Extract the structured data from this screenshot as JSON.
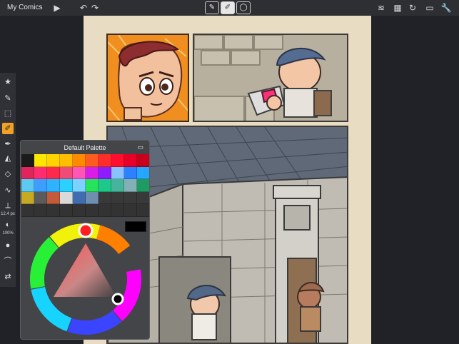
{
  "app": {
    "title": "My Comics"
  },
  "topbar": {
    "icons": [
      "video-icon",
      "undo-icon",
      "redo-icon",
      "layers-icon",
      "grid-icon",
      "refresh-icon",
      "file-icon",
      "wrench-icon"
    ],
    "tool_group": [
      "brush-icon",
      "eraser-icon",
      "lasso-icon"
    ]
  },
  "sidebar": {
    "tools": [
      "star-icon",
      "pen-icon",
      "selection-icon",
      "brush-icon",
      "pen-tool-icon",
      "fill-icon",
      "eraser-icon",
      "curve-icon",
      "opacity-icon",
      "layers-icon",
      "eyedropper-icon",
      "flip-icon"
    ],
    "brush_size": "12.4 px",
    "opacity": "100%"
  },
  "palette": {
    "title": "Default Palette",
    "colors": [
      "#1b1b1b",
      "#ffe600",
      "#ffd400",
      "#ffbf00",
      "#ff8a00",
      "#ff5d20",
      "#ff2c2c",
      "#ff0f2d",
      "#e80026",
      "#c8001d",
      "#e0255d",
      "#ff2d6f",
      "#ff2a4b",
      "#f04a79",
      "#ff55b7",
      "#d91ce6",
      "#8f1bff",
      "#8ac2ff",
      "#2d80ff",
      "#27a6ff",
      "#5cc9f1",
      "#3e9eff",
      "#2fb3ff",
      "#2bd0ff",
      "#7bd2ff",
      "#26e35b",
      "#1cc88a",
      "#46b49b",
      "#82b0b6",
      "#1d9b63",
      "#c6aa24",
      "#5b5b5b",
      "#c35a39",
      "#d9d9d9",
      "#426cb0",
      "#6f8fb0",
      "#393939",
      "#393939",
      "#393939",
      "#393939",
      "#333333",
      "#333333",
      "#333333",
      "#333333",
      "#333333",
      "#333333",
      "#333333",
      "#333333",
      "#333333",
      "#333333"
    ],
    "selected_color": "#000000"
  }
}
